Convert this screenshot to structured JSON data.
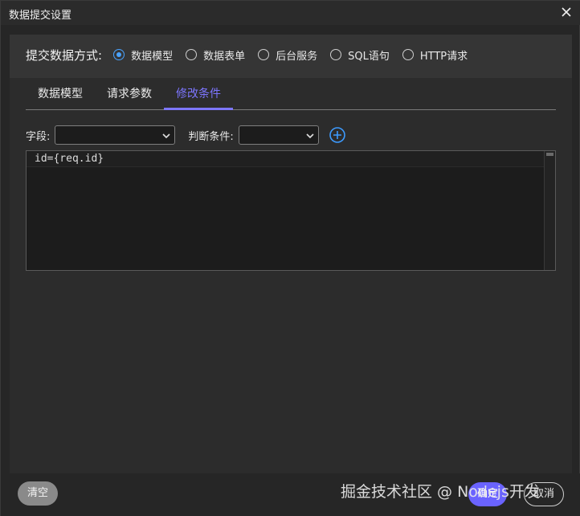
{
  "dialog": {
    "title": "数据提交设置"
  },
  "submit_method": {
    "label": "提交数据方式:",
    "options": [
      {
        "label": "数据模型",
        "checked": true
      },
      {
        "label": "数据表单",
        "checked": false
      },
      {
        "label": "后台服务",
        "checked": false
      },
      {
        "label": "SQL语句",
        "checked": false
      },
      {
        "label": "HTTP请求",
        "checked": false
      }
    ]
  },
  "tabs": [
    {
      "label": "数据模型",
      "active": false
    },
    {
      "label": "请求参数",
      "active": false
    },
    {
      "label": "修改条件",
      "active": true
    }
  ],
  "filter": {
    "field_label": "字段:",
    "field_value": "",
    "condition_label": "判断条件:",
    "condition_value": ""
  },
  "editor": {
    "code": "id={req.id}"
  },
  "footer": {
    "clear_label": "清空",
    "ok_label": "确定",
    "cancel_label": "取消"
  },
  "watermark": "掘金技术社区 @ Nodejs开发",
  "colors": {
    "accent": "#7d76ff",
    "radio_checked": "#4aa3ff",
    "add_icon": "#3d9bff"
  },
  "icons": {
    "close": "close-icon",
    "dropdown": "chevron-down-icon",
    "add": "plus-circle-icon"
  }
}
